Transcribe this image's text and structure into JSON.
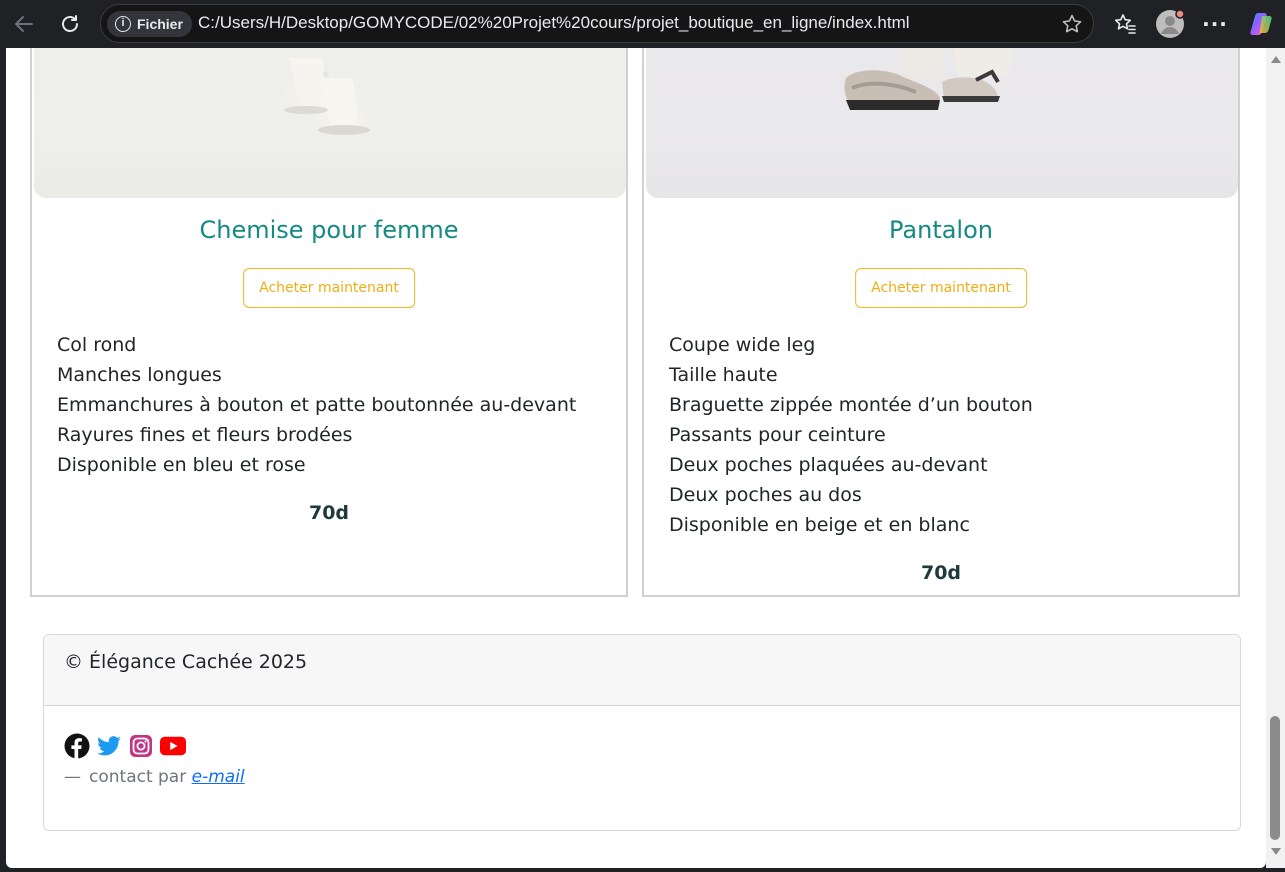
{
  "browser": {
    "chip_label": "Fichier",
    "url": "C:/Users/H/Desktop/GOMYCODE/02%20Projet%20cours/projet_boutique_en_ligne/index.html",
    "icons": [
      "back-icon",
      "reload-icon",
      "info-icon",
      "star-icon",
      "favorites-icon",
      "profile-icon",
      "more-icon",
      "copilot-icon"
    ],
    "more_label": "···"
  },
  "products": [
    {
      "title": "Chemise pour femme",
      "button_label": "Acheter maintenant",
      "features": [
        "Col rond",
        "Manches longues",
        "Emmanchures à bouton et patte boutonnée au-devant",
        "Rayures fines et fleurs brodées",
        "Disponible en bleu et rose"
      ],
      "price": "70d"
    },
    {
      "title": "Pantalon",
      "button_label": "Acheter maintenant",
      "features": [
        "Coupe wide leg",
        "Taille haute",
        "Braguette zippée montée d’un bouton",
        "Passants pour ceinture",
        "Deux poches plaquées au-devant",
        "Deux poches au dos",
        "Disponible en beige et en blanc"
      ],
      "price": "70d"
    }
  ],
  "footer": {
    "copyright": "© Élégance Cachée 2025",
    "socials": [
      "facebook-icon",
      "twitter-icon",
      "instagram-icon",
      "youtube-icon"
    ],
    "contact_dash": "—",
    "contact_prefix": "contact par",
    "contact_link": "e-mail"
  },
  "colors": {
    "title": "#148a82",
    "button": "#f0ad14",
    "link": "#0d6efd"
  }
}
